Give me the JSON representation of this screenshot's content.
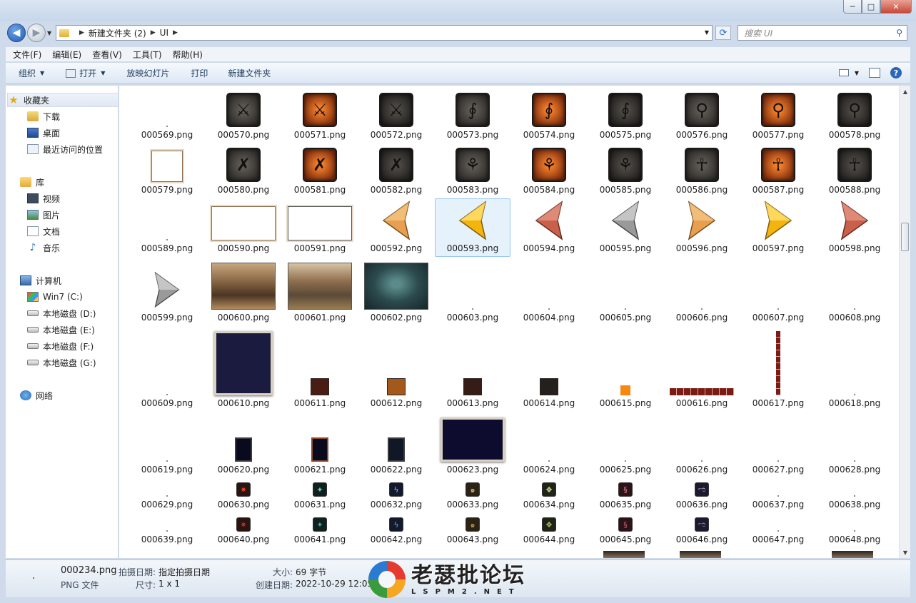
{
  "window": {
    "min": "─",
    "max": "□",
    "close": "✕"
  },
  "address": {
    "crumbs": [
      "新建文件夹 (2)",
      "UI"
    ],
    "search_placeholder": "搜索 UI"
  },
  "menu": [
    "文件(F)",
    "编辑(E)",
    "查看(V)",
    "工具(T)",
    "帮助(H)"
  ],
  "toolbar": {
    "organize": "组织",
    "open": "打开",
    "slideshow": "放映幻灯片",
    "print": "打印",
    "new_folder": "新建文件夹"
  },
  "sidebar": {
    "favorites": "收藏夹",
    "downloads": "下载",
    "desktop": "桌面",
    "recent": "最近访问的位置",
    "libraries": "库",
    "videos": "视频",
    "pictures": "图片",
    "documents": "文档",
    "music": "音乐",
    "computer": "计算机",
    "drives": [
      "Win7 (C:)",
      "本地磁盘 (D:)",
      "本地磁盘 (E:)",
      "本地磁盘 (F:)",
      "本地磁盘 (G:)"
    ],
    "network": "网络"
  },
  "files": {
    "row1": [
      "000569.png",
      "000570.png",
      "000571.png",
      "000572.png",
      "000573.png",
      "000574.png",
      "000575.png",
      "000576.png",
      "000577.png",
      "000578.png"
    ],
    "row2": [
      "000579.png",
      "000580.png",
      "000581.png",
      "000582.png",
      "000583.png",
      "000584.png",
      "000585.png",
      "000586.png",
      "000587.png",
      "000588.png"
    ],
    "row3": [
      "000589.png",
      "000590.png",
      "000591.png",
      "000592.png",
      "000593.png",
      "000594.png",
      "000595.png",
      "000596.png",
      "000597.png",
      "000598.png"
    ],
    "row4": [
      "000599.png",
      "000600.png",
      "000601.png",
      "000602.png",
      "000603.png",
      "000604.png",
      "000605.png",
      "000606.png",
      "000607.png",
      "000608.png"
    ],
    "row5": [
      "000609.png",
      "000610.png",
      "000611.png",
      "000612.png",
      "000613.png",
      "000614.png",
      "000615.png",
      "000616.png",
      "000617.png",
      "000618.png"
    ],
    "row6": [
      "000619.png",
      "000620.png",
      "000621.png",
      "000622.png",
      "000623.png",
      "000624.png",
      "000625.png",
      "000626.png",
      "000627.png",
      "000628.png"
    ],
    "row7": [
      "000629.png",
      "000630.png",
      "000631.png",
      "000632.png",
      "000633.png",
      "000634.png",
      "000635.png",
      "000636.png",
      "000637.png",
      "000638.png"
    ],
    "row8": [
      "000639.png",
      "000640.png",
      "000641.png",
      "000642.png",
      "000643.png",
      "000644.png",
      "000645.png",
      "000646.png",
      "000647.png",
      "000648.png"
    ]
  },
  "details": {
    "name": "000234.png",
    "type": "PNG 文件",
    "date_taken_label": "拍摄日期:",
    "date_taken": "指定拍摄日期",
    "dims_label": "尺寸:",
    "dims": "1 x 1",
    "size_label": "大小:",
    "size": "69 字节",
    "created_label": "创建日期:",
    "created": "2022-10-29 12:05"
  },
  "watermark": {
    "cn": "老瑟批论坛",
    "en": "LSPM2.NET"
  }
}
